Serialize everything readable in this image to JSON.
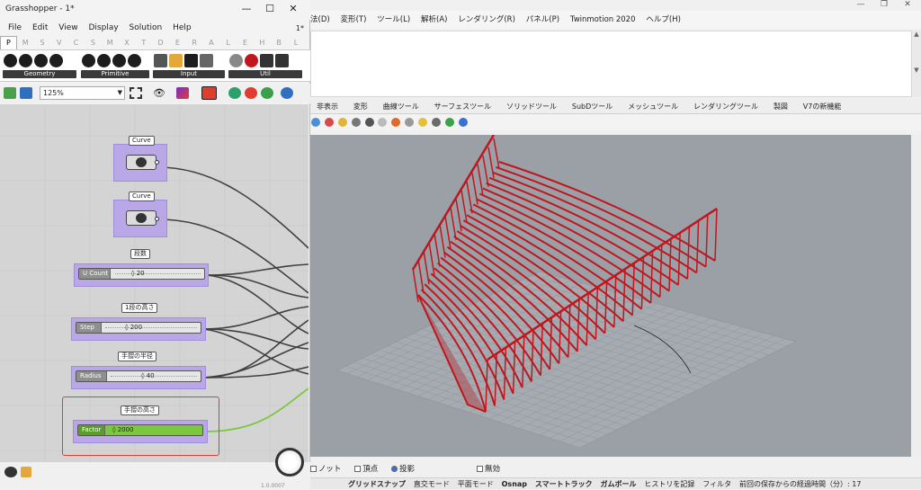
{
  "rhino": {
    "menubar": [
      "法(D)",
      "変形(T)",
      "ツール(L)",
      "解析(A)",
      "レンダリング(R)",
      "パネル(P)",
      "Twinmotion 2020",
      "ヘルプ(H)"
    ],
    "tabs": [
      "非表示",
      "変形",
      "曲線ツール",
      "サーフェスツール",
      "ソリッドツール",
      "SubDツール",
      "メッシュツール",
      "レンダリングツール",
      "製図",
      "V7の新機能"
    ],
    "osnap_row": {
      "knot": "ノット",
      "vertex": "頂点",
      "projection": "投影",
      "disable": "無効"
    },
    "status": {
      "grid_snap": "グリッドスナップ",
      "ortho": "直交モード",
      "planar": "平面モード",
      "osnap": "Osnap",
      "smart_track": "スマートトラック",
      "gumball": "ガムボール",
      "history": "ヒストリを記録",
      "filter": "フィルタ",
      "elapsed": "前回の保存からの経過時間（分）: 17"
    }
  },
  "gh": {
    "title": "Grasshopper - 1*",
    "doc_label": "1*",
    "menu": [
      "File",
      "Edit",
      "View",
      "Display",
      "Solution",
      "Help"
    ],
    "tabs": [
      "P",
      "M",
      "S",
      "V",
      "C",
      "S",
      "M",
      "X",
      "T",
      "D",
      "E",
      "R",
      "A",
      "L",
      "E",
      "H",
      "B",
      "L",
      "K"
    ],
    "ribbon_groups": [
      "Geometry",
      "Primitive",
      "Input",
      "Util"
    ],
    "zoom": "125%",
    "version": "1.0.0007"
  },
  "components": {
    "curve1": {
      "label": "Curve"
    },
    "curve2": {
      "label": "Curve"
    },
    "u_count": {
      "label": "段数",
      "name": "U Count",
      "value": "20"
    },
    "step": {
      "label": "1段の高さ",
      "name": "Step",
      "value": "200"
    },
    "radius": {
      "label": "手摺の半径",
      "name": "Radius",
      "value": "40"
    },
    "factor": {
      "label": "手摺の高さ",
      "name": "Factor",
      "value": "2000"
    }
  },
  "colors": {
    "selection": "#b9a7e8",
    "highlight_border": "#e03c30",
    "factor_green": "#7bc83f",
    "stair_red": "#c0161e",
    "viewport_bg": "#9aa0a6"
  }
}
